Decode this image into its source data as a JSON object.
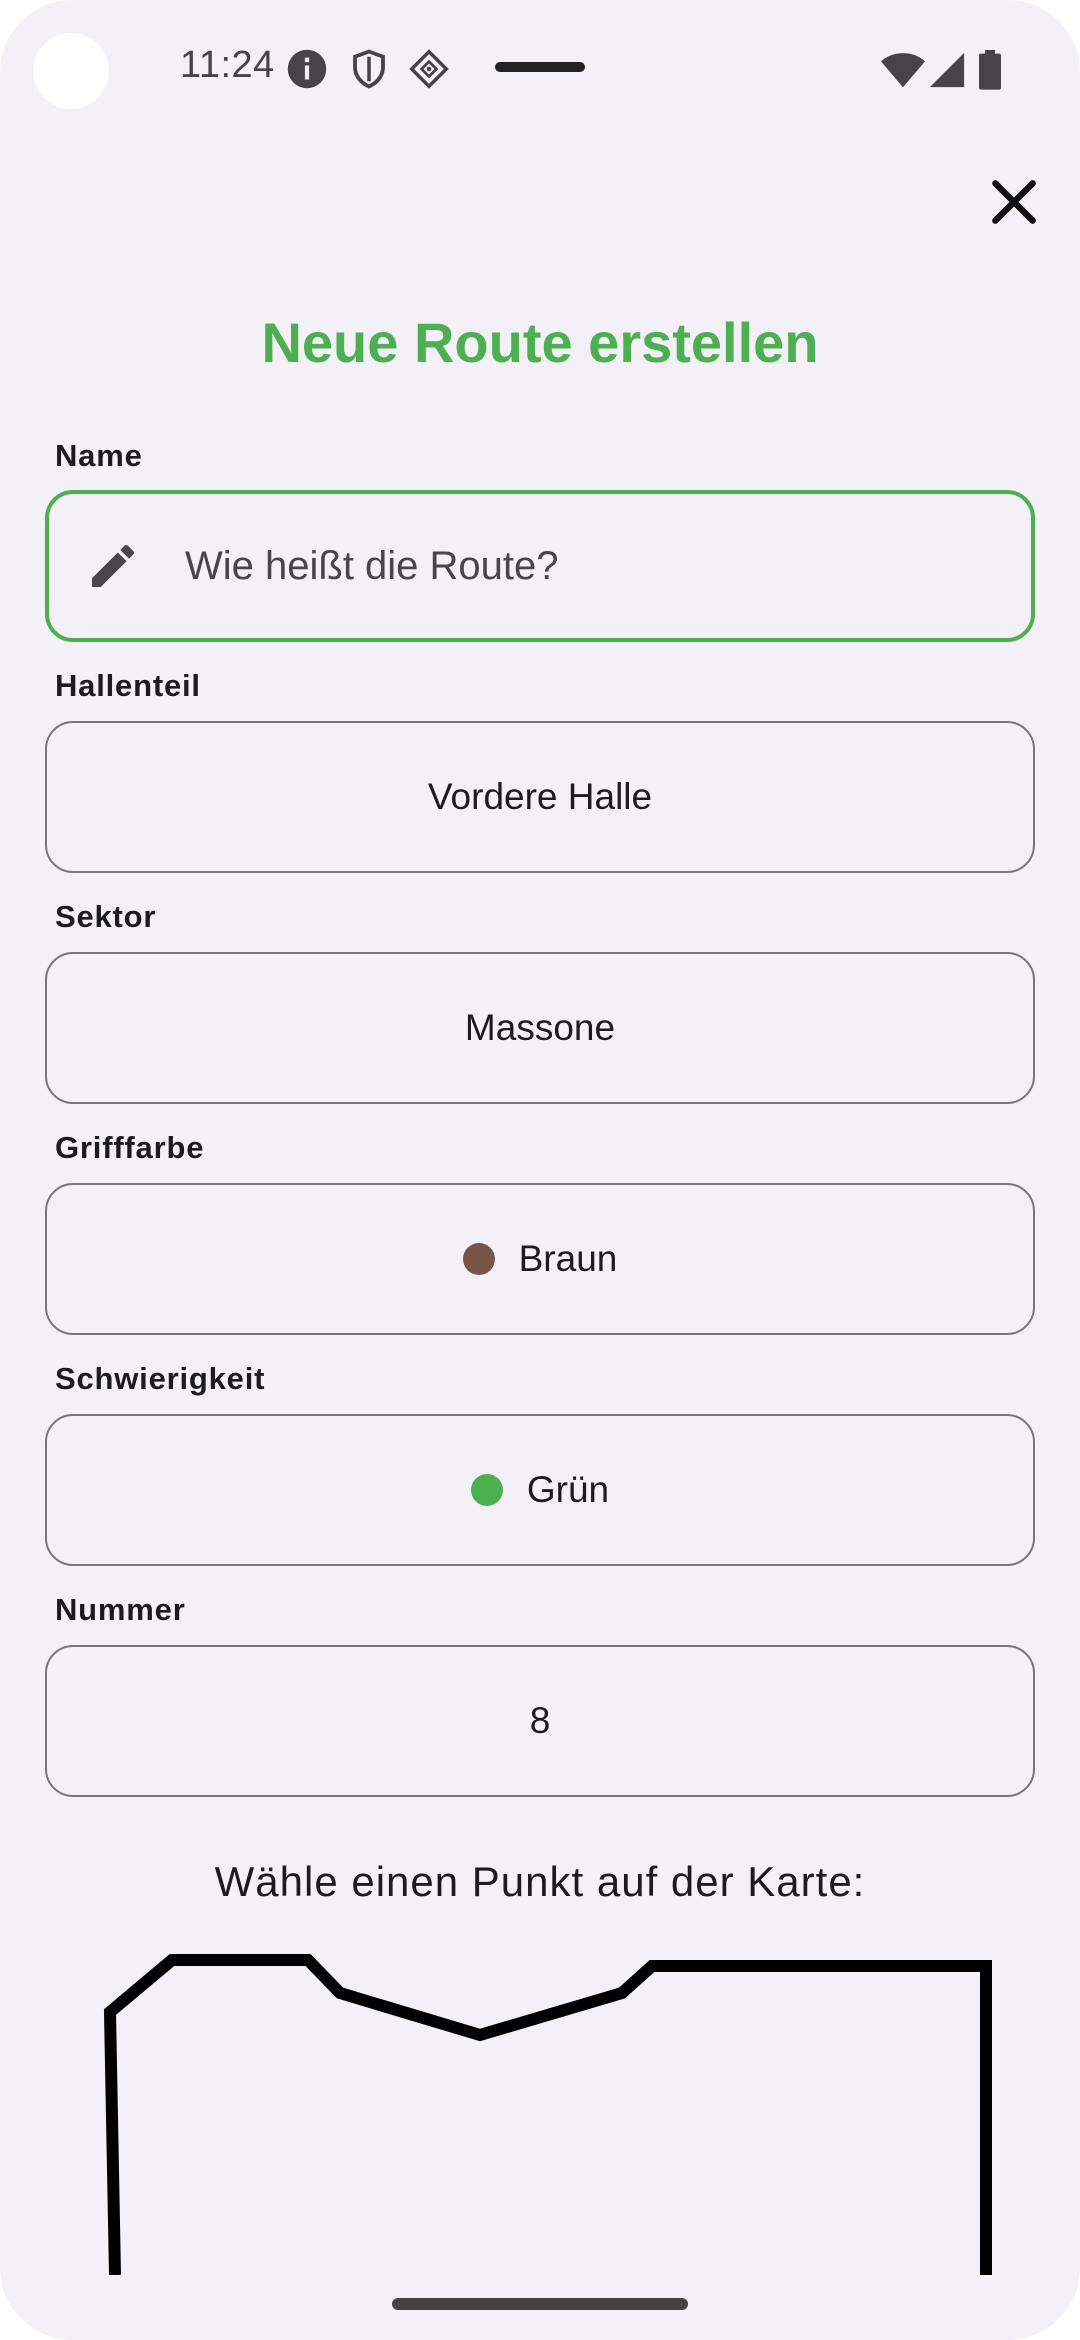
{
  "status_bar": {
    "time": "11:24",
    "icons": [
      "info-icon",
      "shield-icon",
      "cast-icon",
      "wifi-icon",
      "signal-icon",
      "battery-icon"
    ]
  },
  "dialog": {
    "title": "Neue Route erstellen",
    "close_icon": "close-icon",
    "accent_color": "#4caf50"
  },
  "fields": {
    "name": {
      "label": "Name",
      "placeholder": "Wie heißt die Route?",
      "icon": "pencil-icon"
    },
    "hall": {
      "label": "Hallenteil",
      "value": "Vordere Halle"
    },
    "sector": {
      "label": "Sektor",
      "value": "Massone"
    },
    "hold_color": {
      "label": "Grifffarbe",
      "value": "Braun",
      "color": "#795548"
    },
    "difficulty": {
      "label": "Schwierigkeit",
      "value": "Grün",
      "color": "#4caf50"
    },
    "number": {
      "label": "Nummer",
      "value": "8"
    }
  },
  "map": {
    "prompt": "Wähle einen Punkt auf der Karte:"
  }
}
